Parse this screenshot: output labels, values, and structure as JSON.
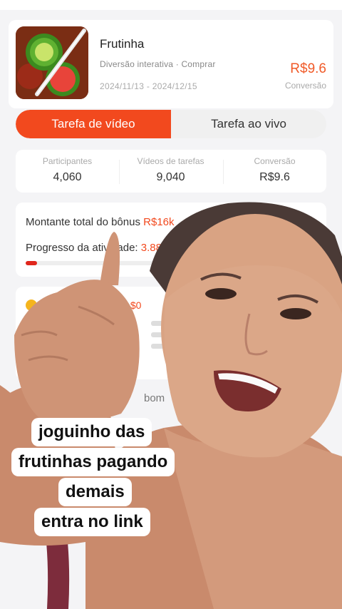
{
  "app": {
    "name": "Frutinha",
    "meta": "Diversão interativa · Comprar",
    "start_date": "2024/11/13",
    "end_date": "2024/12/15",
    "price": "R$9.6",
    "price_label": "Conversão"
  },
  "tabs": [
    "Tarefa de vídeo",
    "Tarefa ao vivo"
  ],
  "stats": [
    {
      "label": "Participantes",
      "value": "4,060"
    },
    {
      "label": "Vídeos de tarefas",
      "value": "9,040"
    },
    {
      "label": "Conversão",
      "value": "R$9.6"
    }
  ],
  "bonus": {
    "total_label": "Montante total do bônus ",
    "total_value": "R$16k",
    "progress_label": "Progresso da atividade: ",
    "progress_value": "3.88%",
    "progress_fraction": 0.0388
  },
  "task": {
    "reward": "s $0"
  },
  "bom_text": "bom",
  "caption": [
    "joguinho das",
    "frutinhas pagando",
    "demais",
    "entra no link"
  ],
  "colors": {
    "accent": "#f2491e",
    "background": "#f4f4f6"
  }
}
